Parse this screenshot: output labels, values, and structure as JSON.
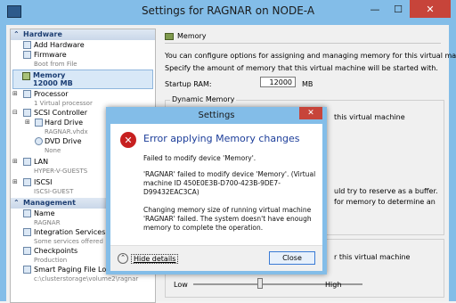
{
  "window": {
    "title": "Settings for RAGNAR on NODE-A",
    "min_glyph": "—",
    "max_glyph": "☐",
    "close_glyph": "✕"
  },
  "tree": {
    "hardware_header": "Hardware",
    "add_hardware": "Add Hardware",
    "firmware": "Firmware",
    "firmware_sub": "Boot from File",
    "memory": "Memory",
    "memory_sub": "12000 MB",
    "processor": "Processor",
    "processor_sub": "1 Virtual processor",
    "scsi": "SCSI Controller",
    "hard_drive": "Hard Drive",
    "hard_drive_sub": "RAGNAR.vhdx",
    "dvd": "DVD Drive",
    "dvd_sub": "None",
    "lan": "LAN",
    "lan_sub": "HYPER-V-GUESTS",
    "iscsi": "ISCSI",
    "iscsi_sub": "ISCSI-GUEST",
    "management_header": "Management",
    "name": "Name",
    "name_sub": "RAGNAR",
    "integration": "Integration Services",
    "integration_sub": "Some services offered",
    "checkpoints": "Checkpoints",
    "checkpoints_sub": "Production",
    "paging": "Smart Paging File Location",
    "paging_sub": "c:\\clusterstorage\\volume2\\ragnar"
  },
  "pane": {
    "header": "Memory",
    "line1": "You can configure options for assigning and managing memory for this virtual machine.",
    "line2": "Specify the amount of memory that this virtual machine will be started with.",
    "startup_label": "Startup RAM:",
    "startup_value": "12000",
    "startup_unit": "MB",
    "dynamic_label": "Dynamic Memory",
    "frag1": "this virtual machine",
    "frag2": "uld try to reserve as a buffer.",
    "frag3": "for memory to determine an",
    "frag4": "r this virtual machine",
    "low": "Low",
    "high": "High"
  },
  "dialog": {
    "title": "Settings",
    "heading": "Error applying Memory changes",
    "p1": "Failed to modify device 'Memory'.",
    "p2": "'RAGNAR' failed to modify device 'Memory'. (Virtual machine ID 450E0E3B-D700-423B-9DE7-D99432EAC3CA)",
    "p3": "Changing memory size of running virtual machine 'RAGNAR' failed. The system doesn't have enough memory to complete the operation.",
    "hide_details": "Hide details",
    "close_button": "Close"
  }
}
